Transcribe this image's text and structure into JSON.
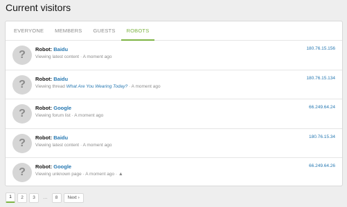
{
  "page": {
    "title": "Current visitors"
  },
  "tabs": [
    {
      "label": "EVERYONE"
    },
    {
      "label": "MEMBERS"
    },
    {
      "label": "GUESTS"
    },
    {
      "label": "ROBOTS",
      "active": true
    }
  ],
  "visitors": [
    {
      "avatar": "?",
      "prefix": "Robot:",
      "name": "Baidu",
      "activity": "Viewing latest content",
      "link": "",
      "separator": "·",
      "time": "A moment ago",
      "ip": "180.76.15.156"
    },
    {
      "avatar": "?",
      "prefix": "Robot:",
      "name": "Baidu",
      "activity": "Viewing thread",
      "link": "What Are You Wearing Today?",
      "separator": "·",
      "time": "A moment ago",
      "ip": "180.76.15.134"
    },
    {
      "avatar": "?",
      "prefix": "Robot:",
      "name": "Google",
      "activity": "Viewing forum list",
      "link": "",
      "separator": "·",
      "time": "A moment ago",
      "ip": "66.249.64.24"
    },
    {
      "avatar": "?",
      "prefix": "Robot:",
      "name": "Baidu",
      "activity": "Viewing latest content",
      "link": "",
      "separator": "·",
      "time": "A moment ago",
      "ip": "180.76.15.34"
    },
    {
      "avatar": "?",
      "prefix": "Robot:",
      "name": "Google",
      "activity": "Viewing unknown page",
      "link": "",
      "separator": "·",
      "time": "A moment ago",
      "ip": "66.249.64.26",
      "warning": "▲"
    }
  ],
  "pagination": {
    "pages": [
      "1",
      "2",
      "3",
      "…",
      "8"
    ],
    "current": "1",
    "next_label": "Next ›"
  },
  "colors": {
    "accent": "#7cb342",
    "link": "#2577b1"
  }
}
